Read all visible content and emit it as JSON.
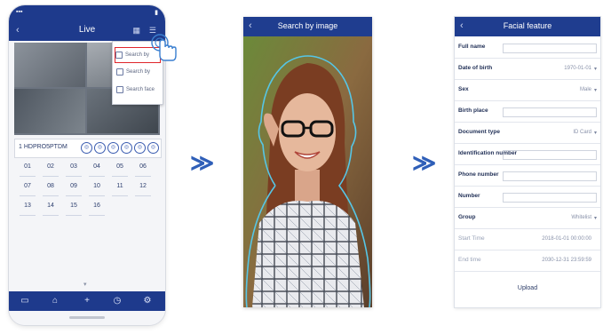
{
  "phone1": {
    "nav_title": "Live",
    "menu_items": [
      "Search by",
      "Search by",
      "Search face"
    ],
    "control_text": "1 HDPRO5PTDM",
    "control_buttons": [
      "◎",
      "◎",
      "◎",
      "◎",
      "◎",
      "◎"
    ],
    "channels": [
      "01",
      "02",
      "03",
      "04",
      "05",
      "06",
      "07",
      "08",
      "09",
      "10",
      "11",
      "12",
      "13",
      "14",
      "15",
      "16"
    ]
  },
  "arrows": [
    "≫",
    "≫"
  ],
  "phone2": {
    "nav_title": "Search by image"
  },
  "phone3": {
    "nav_title": "Facial feature",
    "rows": [
      {
        "label": "Full name",
        "value": ""
      },
      {
        "label": "Date of birth",
        "value": "1970-01-01"
      },
      {
        "label": "Sex",
        "value": "Male"
      },
      {
        "label": "Birth place",
        "value": ""
      },
      {
        "label": "Document type",
        "value": "ID Card"
      },
      {
        "label": "Identification number",
        "value": ""
      },
      {
        "label": "Phone number",
        "value": ""
      },
      {
        "label": "Number",
        "value": ""
      },
      {
        "label": "Group",
        "value": "Whitelist"
      },
      {
        "label": "Start Time",
        "value": "2018-01-01 00:00:00"
      },
      {
        "label": "End time",
        "value": "2030-12-31 23:59:59"
      }
    ],
    "footer": "Upload"
  },
  "colors": {
    "nav": "#1e3a8c",
    "accent": "#2f5fb8",
    "highlight": "#e0262b",
    "face_outline": "#56c6e6"
  }
}
